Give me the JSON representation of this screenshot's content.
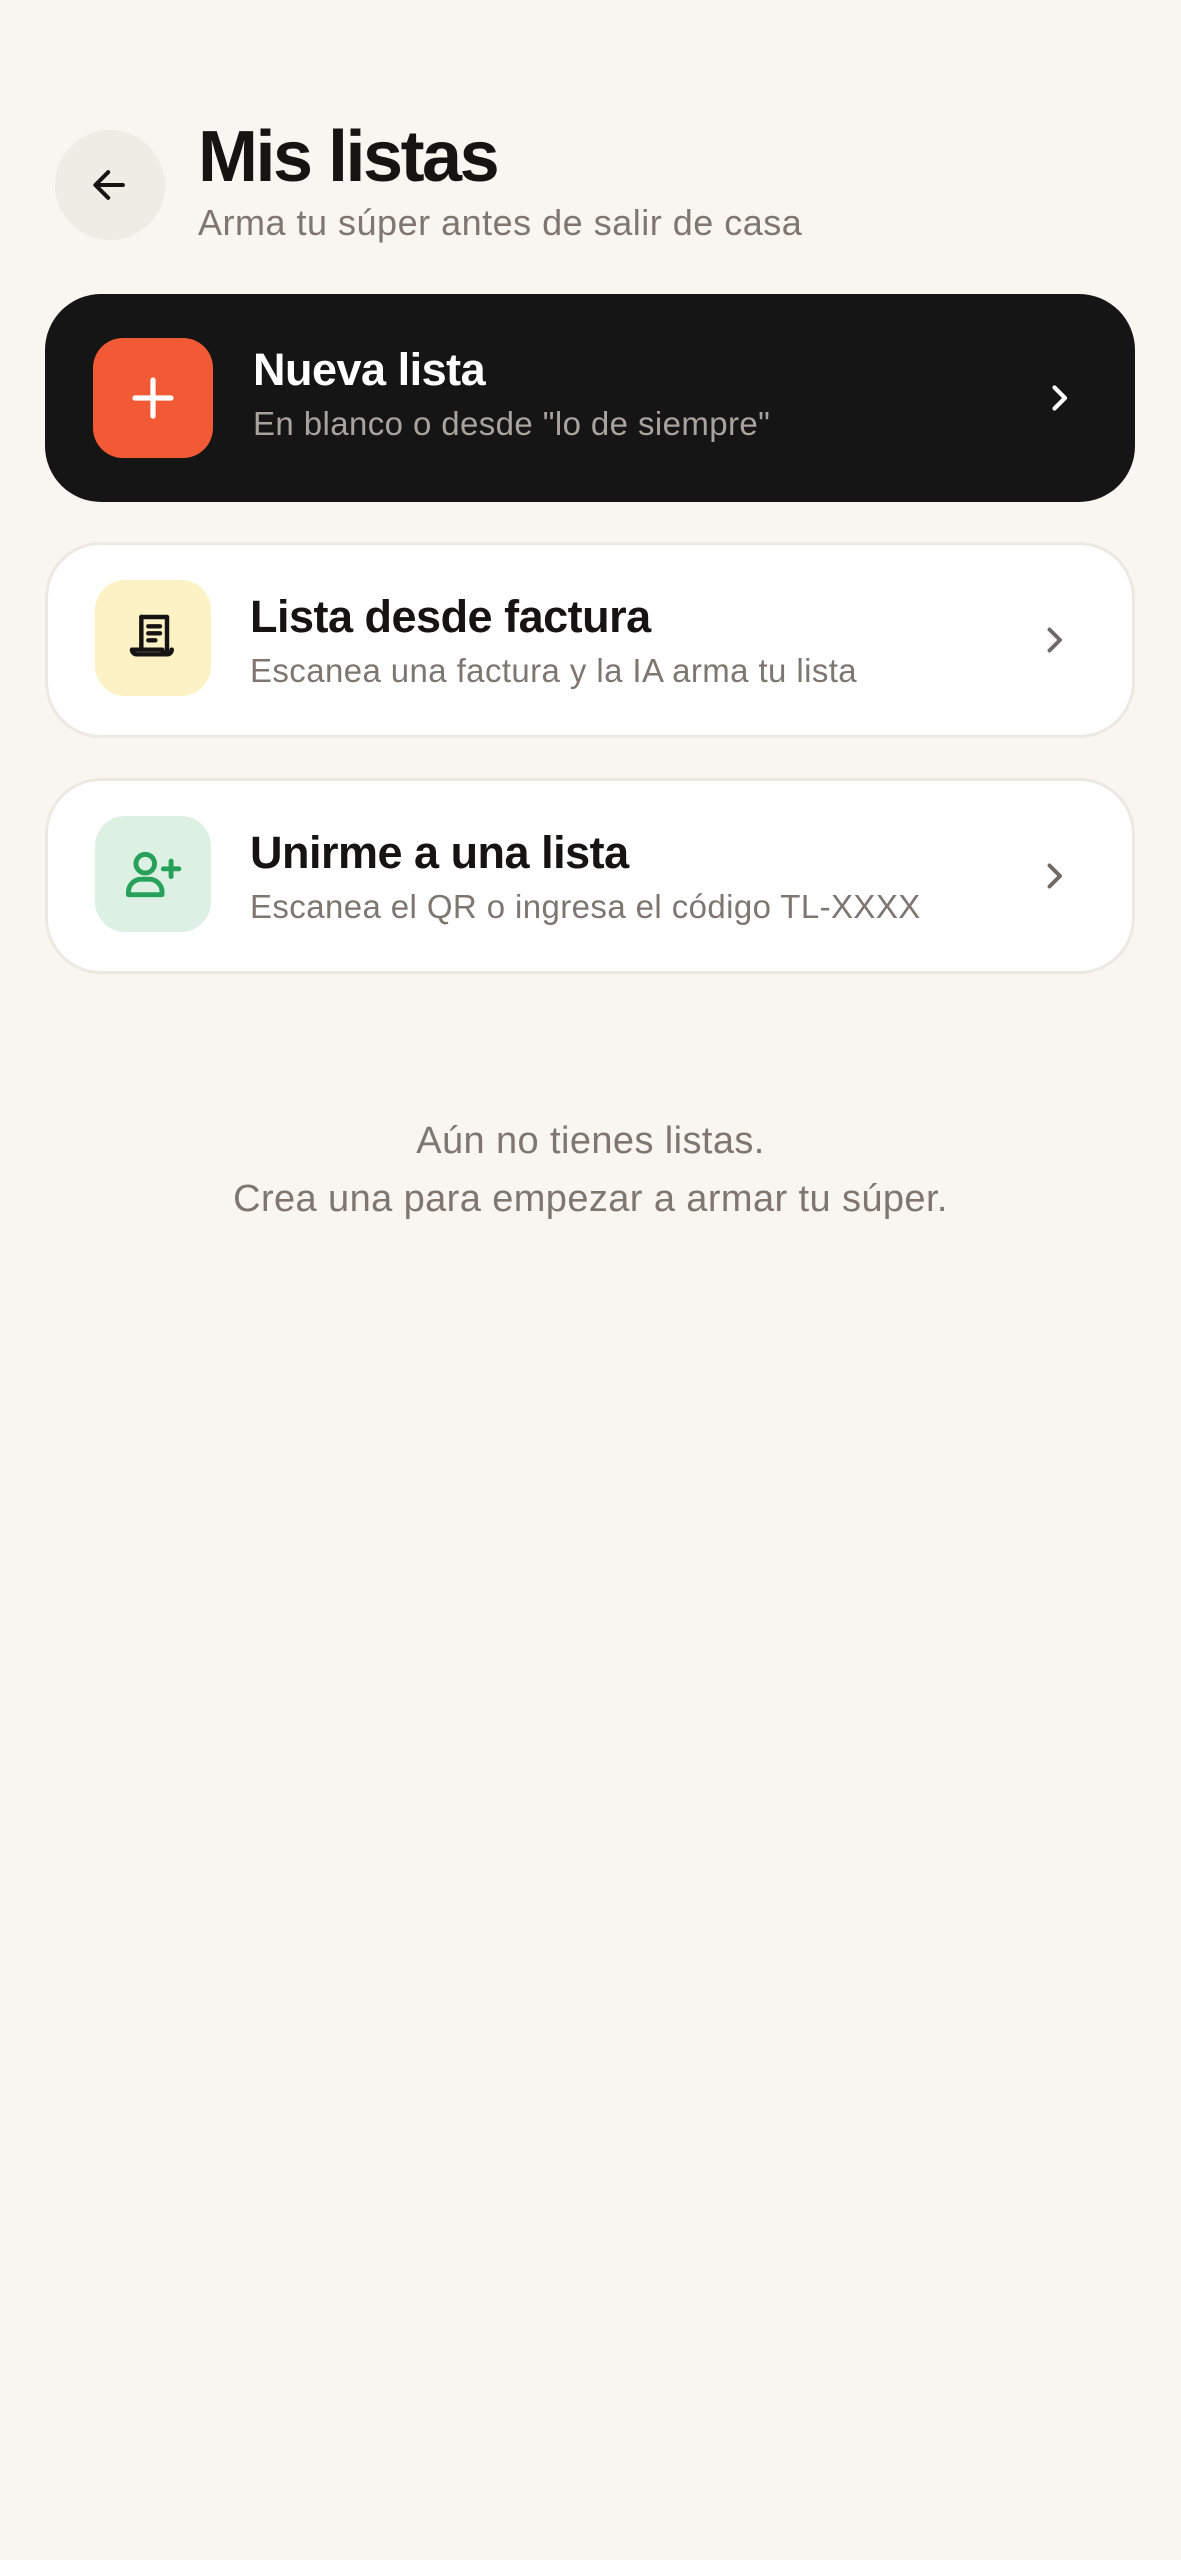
{
  "header": {
    "back_icon": "arrow-left-icon",
    "title": "Mis listas",
    "subtitle": "Arma tu súper antes de salir de casa"
  },
  "actions": [
    {
      "title": "Nueva lista",
      "description": "En blanco o desde \"lo de siempre\"",
      "icon": "plus-icon",
      "icon_bg": "#f25a35"
    },
    {
      "title": "Lista desde factura",
      "description": "Escanea una factura y la IA arma tu lista",
      "icon": "receipt-icon",
      "icon_bg": "#fdf1c6"
    },
    {
      "title": "Unirme a una lista",
      "description": "Escanea el QR o ingresa el código TL-XXXX",
      "icon": "user-plus-icon",
      "icon_bg": "#dcf1e3"
    }
  ],
  "empty_state": {
    "line1": "Aún no tienes listas.",
    "line2": "Crea una para empezar a armar tu súper."
  },
  "colors": {
    "background": "#f9f6f1",
    "primary_card": "#151515",
    "accent": "#f25a35",
    "success": "#27a05a"
  }
}
